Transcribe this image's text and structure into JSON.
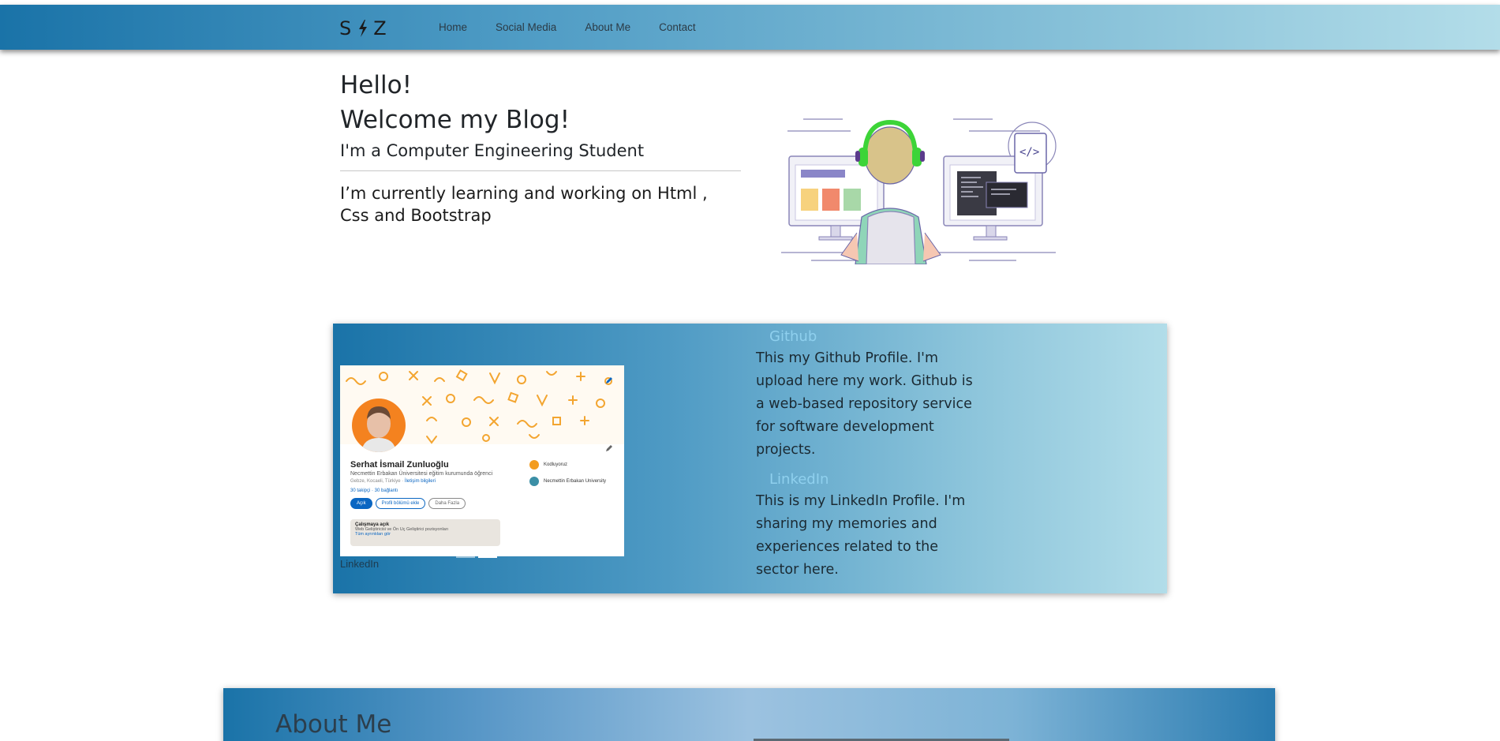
{
  "navbar": {
    "brand_left": "S",
    "brand_right": "Z",
    "brand_icon": "lightning-bolt-icon",
    "links": [
      {
        "label": "Home"
      },
      {
        "label": "Social Media"
      },
      {
        "label": "About Me"
      },
      {
        "label": "Contact"
      }
    ]
  },
  "hero": {
    "line1": "Hello!",
    "line2": "Welcome my Blog!",
    "subtitle": "I'm a Computer Engineering Student",
    "lead": "I’m currently learning and working on Html , Css and Bootstrap",
    "illustration": "developer-at-desk-illustration"
  },
  "social": {
    "carousel": {
      "caption": "LinkedIn",
      "slide_count": 2,
      "active_slide": 2,
      "profile": {
        "name": "Serhat İsmail Zunluoğlu",
        "headline": "Necmettin Erbakan Üniversitesi eğitim kurumunda öğrenci",
        "location": "Gebze, Kocaeli, Türkiye · ",
        "contact_link": "İletişim bilgileri",
        "connections": "30 takipçi · 30 bağlantı",
        "buttons": [
          "Açık",
          "Profil bölümü ekle",
          "Daha Fazla"
        ],
        "open_title": "Çalışmaya açık",
        "open_desc": "Web Geliştiricisi ve Ön Uç Geliştirici pozisyonları",
        "open_link": "Tüm ayrıntıları gör",
        "side_items": [
          "Kodluyoruz",
          "Necmettin Erbakan University"
        ]
      }
    },
    "items": [
      {
        "title": "Github",
        "text": "This my Github Profile. I'm upload here my work. Github is a web-based repository service for software development projects."
      },
      {
        "title": "LinkedIn",
        "text": "This is my LinkedIn Profile. I'm sharing my memories and experiences related to the sector here."
      }
    ]
  },
  "about": {
    "title": "About Me"
  },
  "colors": {
    "accent_blue": "#1a73a8",
    "light_blue": "#b3dde9",
    "link_title": "#8fd0ee"
  }
}
